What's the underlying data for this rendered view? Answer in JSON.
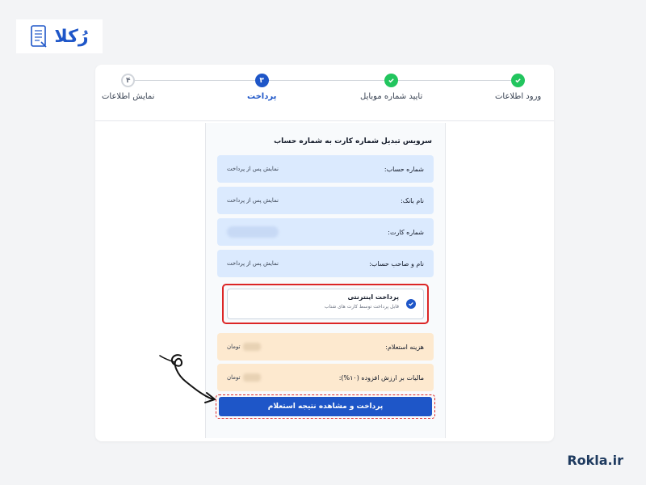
{
  "brand": {
    "logo_text": "رُکلا",
    "url": "Rokla.ir",
    "accent": "#1e56c8"
  },
  "stepper": {
    "steps": [
      {
        "label": "ورود اطلاعات",
        "state": "done",
        "icon": "check-icon"
      },
      {
        "label": "تایید شماره موبایل",
        "state": "done",
        "icon": "check-icon"
      },
      {
        "label": "پرداخت",
        "state": "active",
        "number": "۳"
      },
      {
        "label": "نمایش اطلاعات",
        "state": "todo",
        "number": "۴"
      }
    ]
  },
  "service": {
    "title": "سرویس تبدیل شماره کارت به شماره حساب",
    "rows": [
      {
        "label": "شماره حساب:",
        "value": "نمایش پس از پرداخت"
      },
      {
        "label": "نام بانک:",
        "value": "نمایش پس از پرداخت"
      },
      {
        "label": "شماره کارت:",
        "value": ""
      },
      {
        "label": "نام و صاحب حساب:",
        "value": "نمایش پس از پرداخت"
      }
    ]
  },
  "payment_option": {
    "title": "پرداخت اینترنتی",
    "subtitle": "قابل پرداخت توسط کارت های شتاب"
  },
  "costs": [
    {
      "label": "هزینه استعلام:",
      "unit": "تومان"
    },
    {
      "label": "مالیات بر ارزش افزوده (۱۰%):",
      "unit": "تومان"
    }
  ],
  "submit_label": "پرداخت و مشاهده نتیجه استعلام"
}
